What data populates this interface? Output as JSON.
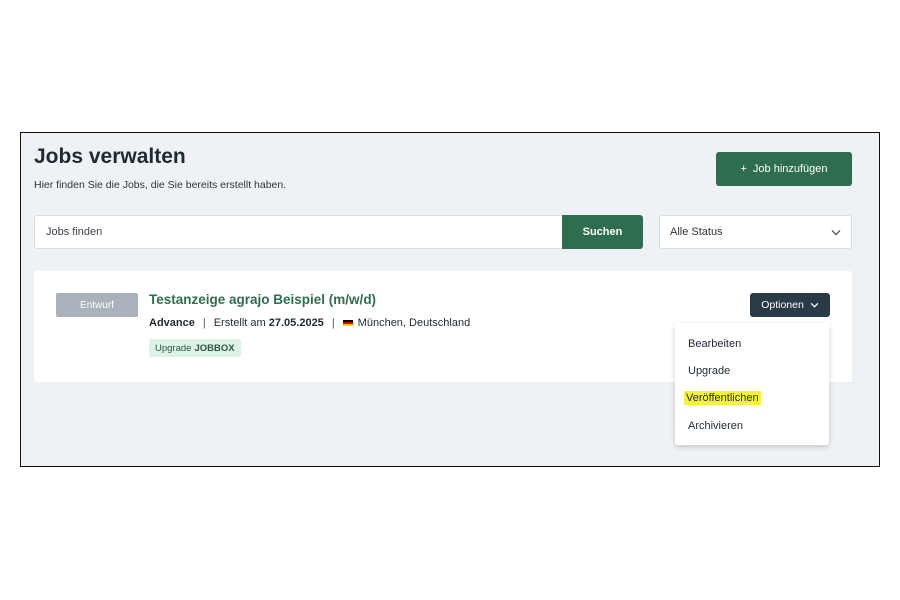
{
  "header": {
    "title": "Jobs verwalten",
    "subtitle": "Hier finden Sie die Jobs, die Sie bereits erstellt haben.",
    "add_button_icon": "plus-icon",
    "add_button_plus": "+",
    "add_button_label": "Job hinzufügen"
  },
  "search": {
    "placeholder": "Jobs finden",
    "value": "",
    "button_label": "Suchen",
    "status_selected": "Alle Status"
  },
  "job": {
    "status_badge": "Entwurf",
    "title": "Testanzeige agrajo Beispiel (m/w/d)",
    "plan": "Advance",
    "sep1": "|",
    "created_prefix": "Erstellt am",
    "created_date": "27.05.2025",
    "sep2": "|",
    "location": "München, Deutschland",
    "upgrade_prefix": "Upgrade",
    "upgrade_product": "JOBBOX",
    "options_label": "Optionen"
  },
  "dropdown": {
    "items": [
      {
        "label": "Bearbeiten"
      },
      {
        "label": "Upgrade"
      },
      {
        "label": "Veröffentlichen"
      },
      {
        "label": "Archivieren"
      }
    ]
  },
  "colors": {
    "primary": "#2f6d4f",
    "dark_button": "#2b3a47",
    "draft_badge": "#a9b1ba",
    "highlight": "#f7f23a",
    "page_bg": "#eff2f5"
  }
}
